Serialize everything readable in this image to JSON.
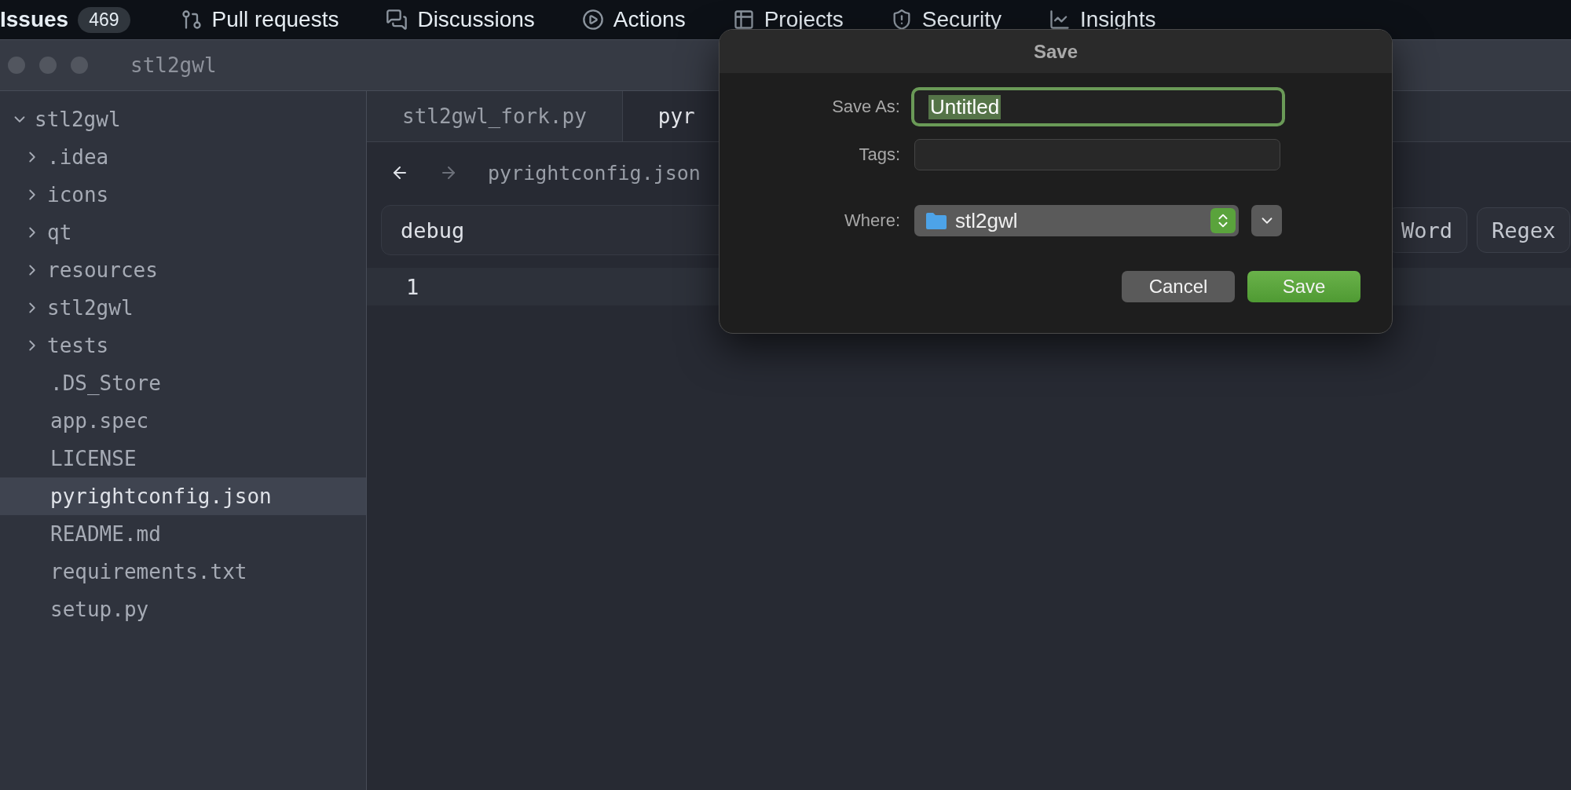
{
  "top_nav": {
    "items": [
      {
        "label": "Issues",
        "count": "469",
        "selected": true
      },
      {
        "label": "Pull requests",
        "selected": false
      },
      {
        "label": "Discussions",
        "selected": false
      },
      {
        "label": "Actions",
        "selected": false
      },
      {
        "label": "Projects",
        "selected": false
      },
      {
        "label": "Security",
        "selected": false
      },
      {
        "label": "Insights",
        "selected": false
      }
    ]
  },
  "window": {
    "title": "stl2gwl"
  },
  "sidebar": {
    "items": [
      {
        "label": "stl2gwl",
        "kind": "folder",
        "expanded": true,
        "selected": false,
        "children": [
          {
            "label": ".idea",
            "kind": "folder",
            "expanded": false,
            "selected": false
          },
          {
            "label": "icons",
            "kind": "folder",
            "expanded": false,
            "selected": false
          },
          {
            "label": "qt",
            "kind": "folder",
            "expanded": false,
            "selected": false
          },
          {
            "label": "resources",
            "kind": "folder",
            "expanded": false,
            "selected": false
          },
          {
            "label": "stl2gwl",
            "kind": "folder",
            "expanded": false,
            "selected": false
          },
          {
            "label": "tests",
            "kind": "folder",
            "expanded": false,
            "selected": false
          },
          {
            "label": ".DS_Store",
            "kind": "file",
            "selected": false
          },
          {
            "label": "app.spec",
            "kind": "file",
            "selected": false
          },
          {
            "label": "LICENSE",
            "kind": "file",
            "selected": false
          },
          {
            "label": "pyrightconfig.json",
            "kind": "file",
            "selected": true
          },
          {
            "label": "README.md",
            "kind": "file",
            "selected": false
          },
          {
            "label": "requirements.txt",
            "kind": "file",
            "selected": false
          },
          {
            "label": "setup.py",
            "kind": "file",
            "selected": false
          }
        ]
      }
    ]
  },
  "editor": {
    "tabs": [
      {
        "label": "stl2gwl_fork.py",
        "selected": false
      },
      {
        "label": "pyr",
        "selected": true
      }
    ],
    "breadcrumb": {
      "path": "pyrightconfig.json"
    },
    "search": {
      "value": "debug",
      "options": [
        "Word",
        "Regex"
      ]
    },
    "lines": [
      "1"
    ]
  },
  "dialog": {
    "title": "Save",
    "save_as": {
      "label": "Save As:",
      "value": "Untitled"
    },
    "tags": {
      "label": "Tags:"
    },
    "where": {
      "label": "Where:",
      "value": "stl2gwl"
    },
    "buttons": [
      {
        "label": "Cancel",
        "kind": "default"
      },
      {
        "label": "Save",
        "kind": "primary"
      }
    ]
  }
}
